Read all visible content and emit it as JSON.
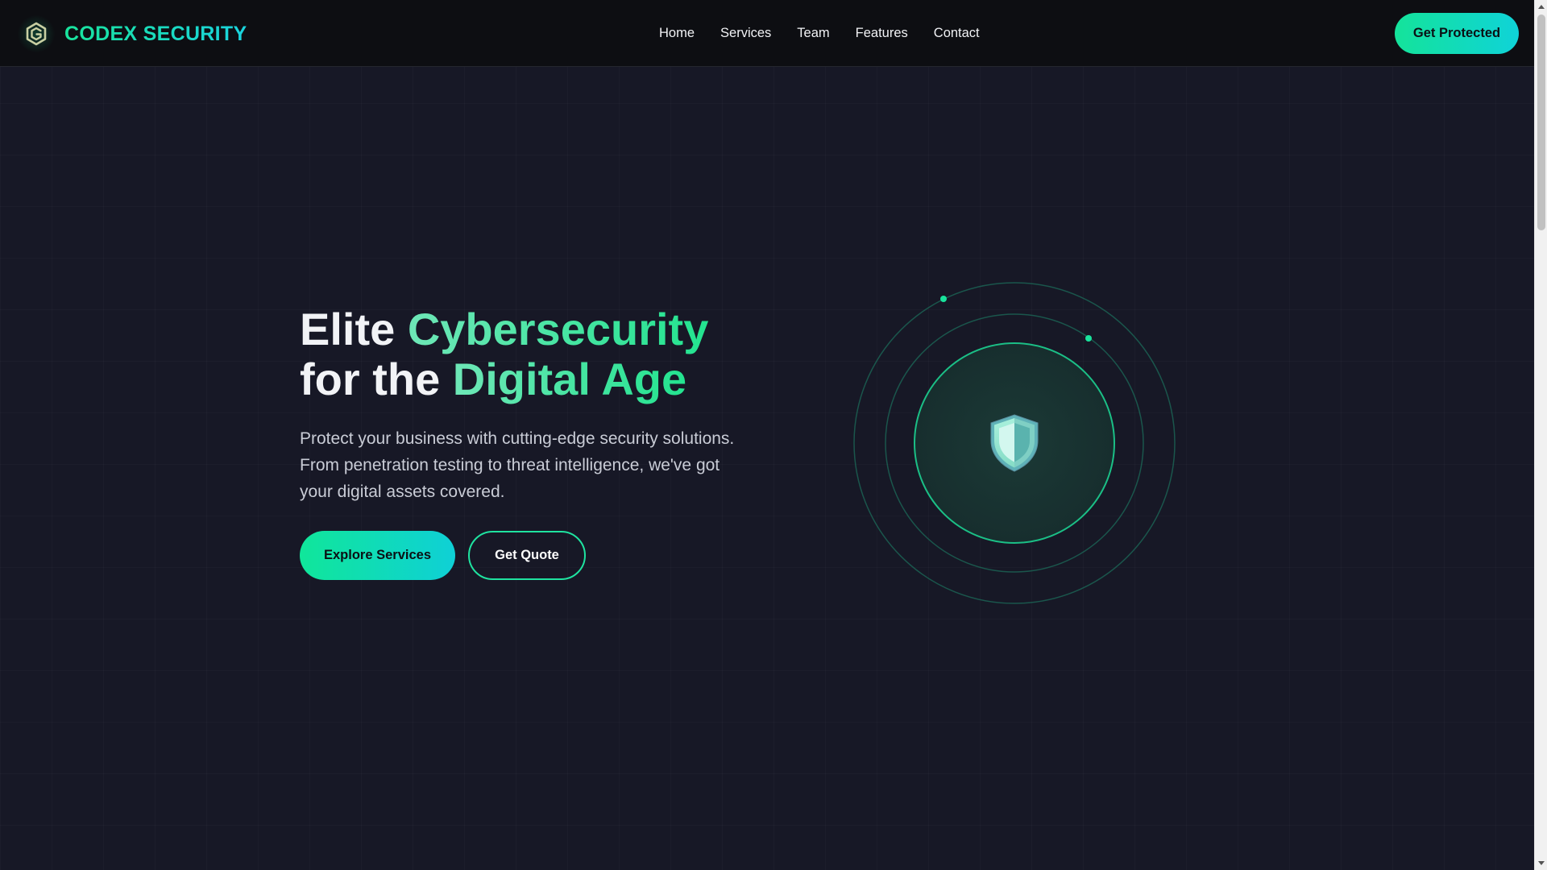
{
  "header": {
    "brand_name": "CODEX SECURITY",
    "logo_icon": "hexagon-shield-logo-icon",
    "nav": [
      {
        "label": "Home"
      },
      {
        "label": "Services"
      },
      {
        "label": "Team"
      },
      {
        "label": "Features"
      },
      {
        "label": "Contact"
      }
    ],
    "cta_label": "Get Protected"
  },
  "hero": {
    "title_line1_plain": "Elite ",
    "title_line1_accent": "Cybersecurity",
    "title_line2_plain": "for the ",
    "title_line2_accent": "Digital Age",
    "description": "Protect your business with cutting-edge security solutions. From penetration testing to threat intelligence, we've got your digital assets covered.",
    "primary_button": "Explore Services",
    "secondary_button": "Get Quote",
    "visual_icon": "shield-icon"
  },
  "colors": {
    "accent_green": "#10e69a",
    "accent_cyan": "#0fd0d6",
    "background": "#171826",
    "header_background": "#0d0e12"
  }
}
